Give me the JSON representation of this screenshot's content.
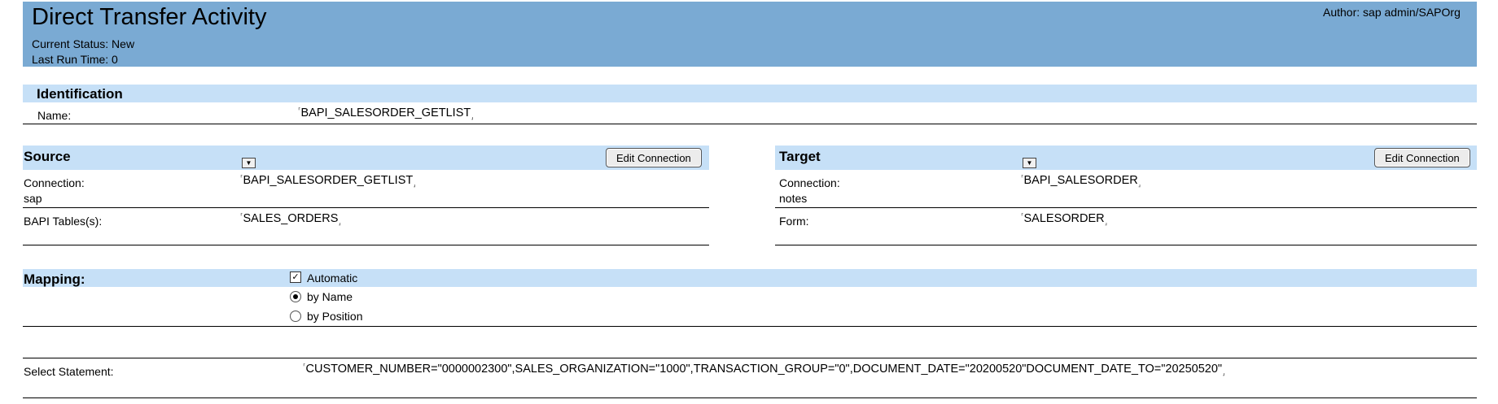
{
  "header": {
    "title": "Direct Transfer Activity",
    "status": "Current Status: New",
    "last_run": "Last Run Time:  0",
    "author": "Author: sap admin/SAPOrg"
  },
  "identification": {
    "heading": "Identification",
    "name_label": "Name:",
    "name_value": "BAPI_SALESORDER_GETLIST"
  },
  "field_marks": {
    "open": "⸢",
    "close": "⸥"
  },
  "source": {
    "heading": "Source",
    "edit_label": "Edit Connection",
    "connection_label": "Connection:",
    "connection_type": "sap",
    "connection_value": "BAPI_SALESORDER_GETLIST",
    "tables_label": "BAPI Tables(s):",
    "tables_value": "SALES_ORDERS"
  },
  "target": {
    "heading": "Target",
    "edit_label": "Edit Connection",
    "connection_label": "Connection:",
    "connection_type": "notes",
    "connection_value": "BAPI_SALESORDER",
    "form_label": "Form:",
    "form_value": "SALESORDER"
  },
  "mapping": {
    "heading": "Mapping:",
    "automatic_label": "Automatic",
    "automatic_checked": true,
    "by_name_label": "by Name",
    "by_position_label": "by Position",
    "selected": "by Name"
  },
  "select_statement": {
    "label": "Select Statement:",
    "value": "CUSTOMER_NUMBER=\"0000002300\",SALES_ORGANIZATION=\"1000\",TRANSACTION_GROUP=\"0\",DOCUMENT_DATE=\"20200520\"DOCUMENT_DATE_TO=\"20250520\""
  },
  "colors": {
    "header_bg": "#7aaad3",
    "section_band": "#c6e0f7"
  }
}
